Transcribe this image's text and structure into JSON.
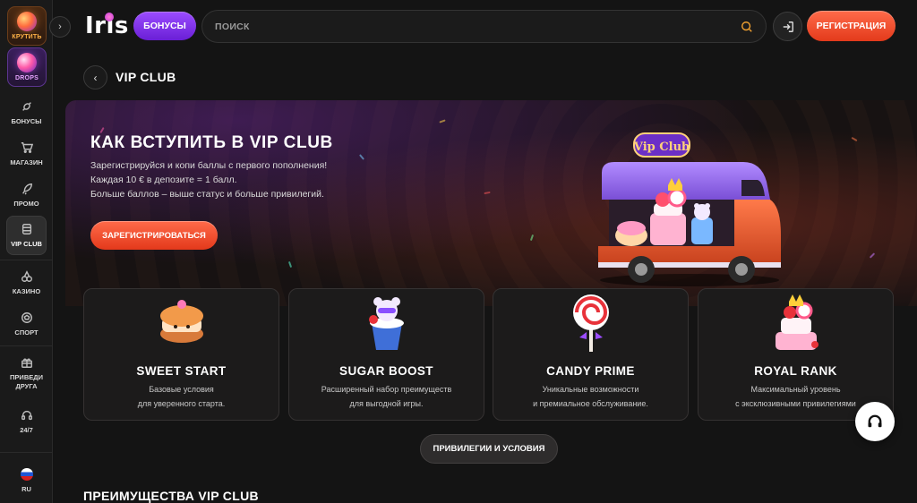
{
  "sidebar": {
    "spin_label": "КРУТИТЬ",
    "drops_label": "DROPS",
    "items": [
      {
        "label": "БОНУСЫ"
      },
      {
        "label": "МАГАЗИН"
      },
      {
        "label": "ПРОМО"
      },
      {
        "label": "VIP CLUB"
      },
      {
        "label": "КАЗИНО"
      },
      {
        "label": "СПОРТ"
      },
      {
        "label": "ПРИВЕДИ ДРУГА"
      },
      {
        "label": "24/7"
      }
    ],
    "language": "RU"
  },
  "header": {
    "logo_text": "Iris",
    "bonus_label": "БОНУСЫ",
    "search_placeholder": "ПОИСК",
    "register_label": "РЕГИСТРАЦИЯ"
  },
  "breadcrumb": {
    "title": "VIP CLUB"
  },
  "hero": {
    "heading": "КАК ВСТУПИТЬ В VIP CLUB",
    "lines": [
      "Зарегистрируйся и копи баллы с первого пополнения!",
      "Каждая 10 € в депозите = 1 балл.",
      "Больше баллов – выше статус и больше привилегий."
    ],
    "cta_label": "ЗАРЕГИСТРИРОВАТЬСЯ",
    "sign_text": "Vip Club"
  },
  "tiers": [
    {
      "name": "SWEET START",
      "desc": [
        "Базовые условия",
        "для уверенного старта."
      ]
    },
    {
      "name": "SUGAR BOOST",
      "desc": [
        "Расширенный набор преимуществ",
        "для выгодной игры."
      ]
    },
    {
      "name": "CANDY PRIME",
      "desc": [
        "Уникальные возможности",
        "и премиальное обслуживание."
      ]
    },
    {
      "name": "ROYAL RANK",
      "desc": [
        "Максимальный уровень",
        "с эксклюзивными привилегиями"
      ]
    }
  ],
  "privileges_label": "ПРИВИЛЕГИИ И УСЛОВИЯ",
  "section_title": "ПРЕИМУЩЕСТВА VIP CLUB",
  "colors": {
    "accent_orange": "#f0502e",
    "accent_purple": "#7b2ff0",
    "background": "#141414"
  }
}
